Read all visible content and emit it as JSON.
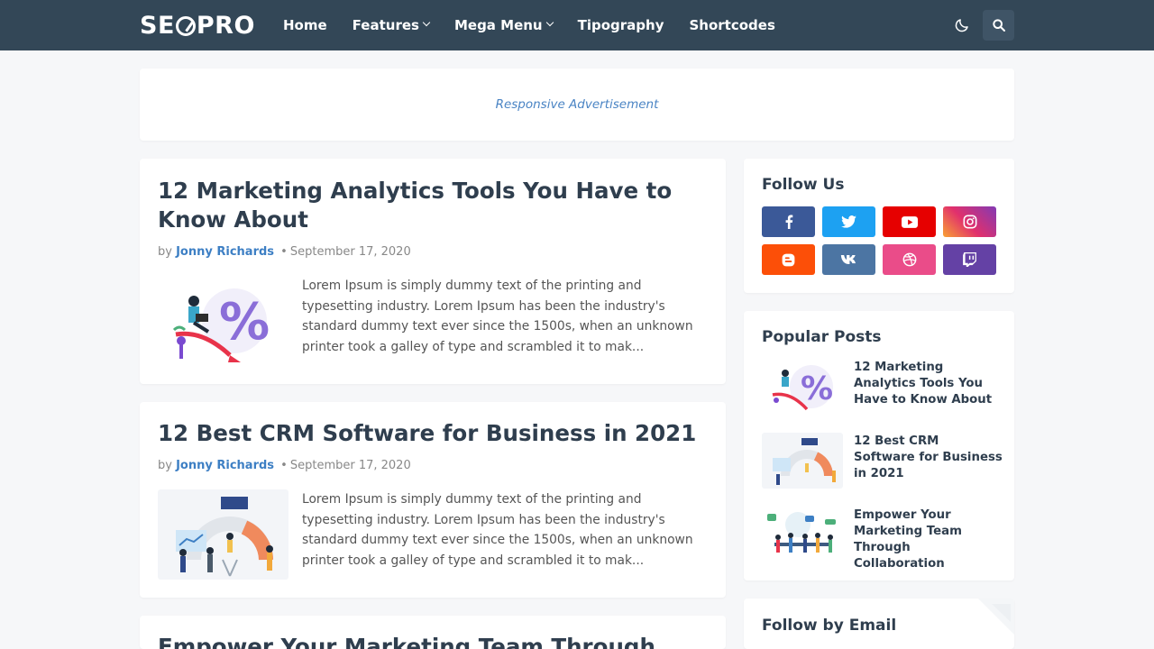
{
  "header": {
    "logo": {
      "left": "SE",
      "right": "PRO"
    },
    "nav": [
      {
        "label": "Home",
        "dropdown": false
      },
      {
        "label": "Features",
        "dropdown": true
      },
      {
        "label": "Mega Menu",
        "dropdown": true
      },
      {
        "label": "Tipography",
        "dropdown": false
      },
      {
        "label": "Shortcodes",
        "dropdown": false
      }
    ],
    "icons": {
      "theme_toggle": "moon-icon",
      "search": "search-icon"
    }
  },
  "ad": {
    "label": "Responsive Advertisement"
  },
  "posts": [
    {
      "title": "12 Marketing Analytics Tools You Have to Know About",
      "by": "by",
      "author": "Jonny Richards",
      "date": "September 17, 2020",
      "excerpt": "Lorem Ipsum is simply dummy text of the printing and typesetting industry. Lorem Ipsum has been the industry's standard dummy text ever since the 1500s, when an unknown printer took a galley of type and scrambled it to mak..."
    },
    {
      "title": "12 Best CRM Software for Business in 2021",
      "by": "by",
      "author": "Jonny Richards",
      "date": "September 17, 2020",
      "excerpt": "Lorem Ipsum is simply dummy text of the printing and typesetting industry. Lorem Ipsum has been the industry's standard dummy text ever since the 1500s, when an unknown printer took a galley of type and scrambled it to mak..."
    },
    {
      "title": "Empower Your Marketing Team Through"
    }
  ],
  "sidebar": {
    "follow": {
      "title": "Follow Us",
      "networks": [
        {
          "name": "facebook",
          "color": "#3b5998"
        },
        {
          "name": "twitter",
          "color": "#1da1f2"
        },
        {
          "name": "youtube",
          "color": "#e60000"
        },
        {
          "name": "instagram",
          "color": "#c13584"
        },
        {
          "name": "blogger",
          "color": "#fc4f08"
        },
        {
          "name": "vk",
          "color": "#4c75a3"
        },
        {
          "name": "dribbble",
          "color": "#ea4c89"
        },
        {
          "name": "twitch",
          "color": "#6441a5"
        }
      ]
    },
    "popular": {
      "title": "Popular Posts",
      "items": [
        {
          "title": "12 Marketing Analytics Tools You Have to Know About"
        },
        {
          "title": "12 Best CRM Software for Business in 2021"
        },
        {
          "title": "Empower Your Marketing Team Through Collaboration"
        }
      ]
    },
    "email": {
      "title": "Follow by Email"
    }
  },
  "colors": {
    "header_bg": "#334757",
    "accent": "#3d7fc4",
    "page_bg": "#f6f7f9"
  }
}
